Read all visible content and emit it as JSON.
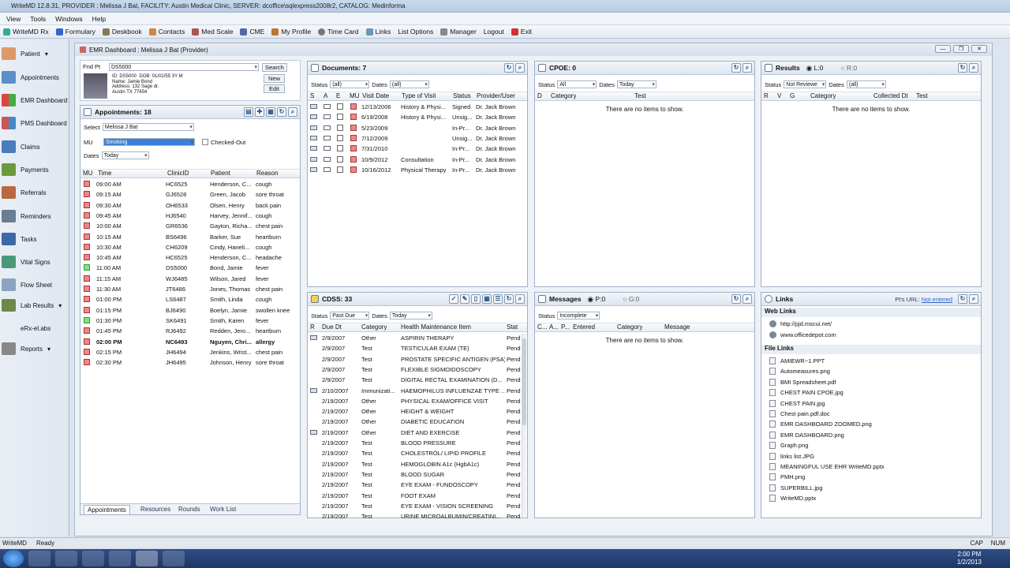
{
  "window": {
    "title": "WriteMD 12.8.31, PROVIDER : Melissa J Bat, FACILITY: Austin Medical Clinic, SERVER: dcoffice\\sqlexpress2008r2, CATALOG: Medinforma"
  },
  "menu": [
    "View",
    "Tools",
    "Windows",
    "Help"
  ],
  "toolbar": [
    "WriteMD Rx",
    "Formulary",
    "Deskbook",
    "Contacts",
    "Med Scale",
    "CME",
    "My Profile",
    "Time Card",
    "Links",
    "List Options",
    "Manager",
    "Logout",
    "Exit"
  ],
  "nav": [
    "Patient",
    "Appointments",
    "EMR Dashboard",
    "PMS Dashboard",
    "Claims",
    "Payments",
    "Referrals",
    "Reminders",
    "Tasks",
    "Vital Signs",
    "Flow Sheet",
    "Lab Results",
    "eRx-el.abs",
    "Reports"
  ],
  "dashboard": {
    "title": "EMR Dashboard : Melissa J Bat (Provider)"
  },
  "patient": {
    "find_label": "Fnd Pt",
    "find_value": "DS5000",
    "search": "Search",
    "new": "New",
    "edit": "Edit",
    "id": "ID: DS5000",
    "dob": "DOB: 01/02/55  3Y M",
    "name": "Name: Jamie Bond",
    "address": "Address: 132 Sage dr.",
    "city": "Austin  TX  77654"
  },
  "appointments": {
    "title": "Appointments: 18",
    "select_label": "Select",
    "select_value": "Melissa J Bat",
    "mu_label": "MU",
    "mu_value": "Smoking",
    "checked_out": "Checked-Out",
    "dates_label": "Dates",
    "dates_value": "Today",
    "columns": [
      "MU",
      "Time",
      "ClinicID",
      "Patient",
      "Reason"
    ],
    "rows": [
      {
        "time": "09:00 AM",
        "id": "HC6525",
        "patient": "Henderson, C...",
        "reason": "cough"
      },
      {
        "time": "09:15 AM",
        "id": "GJ6528",
        "patient": "Green, Jacob",
        "reason": "sore throat"
      },
      {
        "time": "09:30 AM",
        "id": "OH6533",
        "patient": "Olsen, Henry",
        "reason": "back pain"
      },
      {
        "time": "09:45 AM",
        "id": "HJ6540",
        "patient": "Harvey, Jennif...",
        "reason": "cough"
      },
      {
        "time": "10:00 AM",
        "id": "GR6536",
        "patient": "Gayton, Richa...",
        "reason": "chest pain"
      },
      {
        "time": "10:15 AM",
        "id": "BS6496",
        "patient": "Barker, Sue",
        "reason": "heartburn"
      },
      {
        "time": "10:30 AM",
        "id": "CH6209",
        "patient": "Cindy, Haneli...",
        "reason": "cough"
      },
      {
        "time": "10:45 AM",
        "id": "HC6525",
        "patient": "Henderson, C...",
        "reason": "headache"
      },
      {
        "time": "11:00 AM",
        "id": "DS5000",
        "patient": "Bond, Jamie",
        "reason": "fever"
      },
      {
        "time": "11:15 AM",
        "id": "WJ6485",
        "patient": "Wilson, Jared",
        "reason": "fever"
      },
      {
        "time": "11:30 AM",
        "id": "JT6486",
        "patient": "Jones, Thomas",
        "reason": "chest pain"
      },
      {
        "time": "01:00 PM",
        "id": "LS6487",
        "patient": "Smith, Linda",
        "reason": "cough"
      },
      {
        "time": "01:15 PM",
        "id": "BJ6490",
        "patient": "Boelyn, Jamie",
        "reason": "swollen knee"
      },
      {
        "time": "01:30 PM",
        "id": "SK6491",
        "patient": "Smith, Karen",
        "reason": "fever"
      },
      {
        "time": "01:45 PM",
        "id": "RJ6492",
        "patient": "Redden, Jero...",
        "reason": "heartburn"
      },
      {
        "time": "02:00 PM",
        "id": "NC6493",
        "patient": "Nguyen, Chri...",
        "reason": "allergy"
      },
      {
        "time": "02:15 PM",
        "id": "JH6494",
        "patient": "Jenkins, Wrist...",
        "reason": "chest pain"
      },
      {
        "time": "02:30 PM",
        "id": "JH6495",
        "patient": "Johnson, Henry",
        "reason": "sore throat"
      }
    ],
    "tabs": [
      "Appointments",
      "Resources",
      "Rounds",
      "Work List"
    ]
  },
  "documents": {
    "title": "Documents: 7",
    "status_label": "Status",
    "status_value": "(all)",
    "dates_label": "Dates",
    "dates_value": "(all)",
    "columns": [
      "S",
      "A",
      "E",
      "MU",
      "Visit Date",
      "Type of Visit",
      "Status",
      "Provider/User"
    ],
    "rows": [
      {
        "date": "12/13/2006",
        "type": "History & Physi...",
        "status": "Signed",
        "provider": "Dr. Jack Brown"
      },
      {
        "date": "6/19/2008",
        "type": "History & Physi...",
        "status": "Unsig...",
        "provider": "Dr. Jack Brown"
      },
      {
        "date": "5/23/2009",
        "type": "",
        "status": "In-Pr...",
        "provider": "Dr. Jack Brown"
      },
      {
        "date": "7/12/2009",
        "type": "",
        "status": "Unsig...",
        "provider": "Dr. Jack Brown"
      },
      {
        "date": "7/31/2010",
        "type": "",
        "status": "In-Pr...",
        "provider": "Dr. Jack Brown"
      },
      {
        "date": "10/9/2012",
        "type": "Consultation",
        "status": "In-Pr...",
        "provider": "Dr. Jack Brown"
      },
      {
        "date": "10/16/2012",
        "type": "Physical Therapy",
        "status": "In-Pr...",
        "provider": "Dr. Jack Brown"
      }
    ]
  },
  "cpoe": {
    "title": "CPOE: 0",
    "status_label": "Status",
    "status_value": "All",
    "dates_label": "Dates",
    "dates_value": "Today",
    "columns": [
      "D",
      "Category",
      "Test"
    ],
    "empty": "There are no items to show."
  },
  "results": {
    "title": "Results",
    "l": "L:0",
    "r": "R:0",
    "status_label": "Status",
    "status_value": "Not Reviewe",
    "dates_label": "Dates",
    "dates_value": "(all)",
    "columns": [
      "R",
      "V",
      "G",
      "Category",
      "Collected Dt",
      "Test"
    ],
    "empty": "There are no items to show."
  },
  "cdss": {
    "title": "CDSS: 33",
    "status_label": "Status",
    "status_value": "Past Due",
    "dates_label": "Dates",
    "dates_value": "Today",
    "columns": [
      "R",
      "Due Dt",
      "Category",
      "Health Maintenance Item",
      "Stat"
    ],
    "rows": [
      {
        "due": "2/9/2007",
        "cat": "Other",
        "item": "ASPIRIN THERAPY",
        "stat": "Pend"
      },
      {
        "due": "2/9/2007",
        "cat": "Test",
        "item": "TESTICULAR EXAM (TE)",
        "stat": "Pend"
      },
      {
        "due": "2/9/2007",
        "cat": "Test",
        "item": "PROSTATE SPECIFIC ANTIGEN (PSA)",
        "stat": "Pend"
      },
      {
        "due": "2/9/2007",
        "cat": "Test",
        "item": "FLEXIBLE SIGMOIDOSCOPY",
        "stat": "Pend"
      },
      {
        "due": "2/9/2007",
        "cat": "Test",
        "item": "DIGITAL RECTAL EXAMINATION (D...",
        "stat": "Pend"
      },
      {
        "due": "2/10/2007",
        "cat": "Immunizati...",
        "item": "HAEMOPHILUS INFLUENZAE TYPE ...",
        "stat": "Pend"
      },
      {
        "due": "2/19/2007",
        "cat": "Other",
        "item": "PHYSICAL EXAM/OFFICE VISIT",
        "stat": "Pend"
      },
      {
        "due": "2/19/2007",
        "cat": "Other",
        "item": "HEIGHT & WEIGHT",
        "stat": "Pend"
      },
      {
        "due": "2/19/2007",
        "cat": "Other",
        "item": "DIABETIC EDUCATION",
        "stat": "Pend"
      },
      {
        "due": "2/19/2007",
        "cat": "Other",
        "item": "DIET AND EXERCISE",
        "stat": "Pend"
      },
      {
        "due": "2/19/2007",
        "cat": "Test",
        "item": "BLOOD PRESSURE",
        "stat": "Pend"
      },
      {
        "due": "2/19/2007",
        "cat": "Test",
        "item": "CHOLESTROL/ LIPID PROFILE",
        "stat": "Pend"
      },
      {
        "due": "2/19/2007",
        "cat": "Test",
        "item": "HEMOGLOBIN A1c (HgbA1c)",
        "stat": "Pend"
      },
      {
        "due": "2/19/2007",
        "cat": "Test",
        "item": "BLOOD SUGAR",
        "stat": "Pend"
      },
      {
        "due": "2/19/2007",
        "cat": "Test",
        "item": "EYE EXAM - FUNDOSCOPY",
        "stat": "Pend"
      },
      {
        "due": "2/19/2007",
        "cat": "Test",
        "item": "FOOT EXAM",
        "stat": "Pend"
      },
      {
        "due": "2/19/2007",
        "cat": "Test",
        "item": "EYE EXAM - VISION SCREENING",
        "stat": "Pend"
      },
      {
        "due": "2/19/2007",
        "cat": "Test",
        "item": "URINE MICROALBUMIN/CREATINI...",
        "stat": "Pend"
      }
    ]
  },
  "messages": {
    "title": "Messages",
    "p": "P:0",
    "g": "G:0",
    "status_label": "Status",
    "status_value": "Incomplete",
    "columns": [
      "C...",
      "A...",
      "P...",
      "Entered",
      "Category",
      "Message"
    ],
    "empty": "There are no items to show."
  },
  "links": {
    "title": "Links",
    "pts_url_label": "Pt's URL:",
    "pts_url_value": "Not entered",
    "web_label": "Web Links",
    "web": [
      "http://pjd.mscui.net/",
      "www.officedepot.com"
    ],
    "file_label": "File Links",
    "files": [
      "AMIEWR~1.PPT",
      "Automeasures.png",
      "BMI Spreadsheet.pdf",
      "CHEST PAIN CPOE.jpg",
      "CHEST PAIN.jpg",
      "Chest pain.pdf.doc",
      "EMR DASHBOARD ZOOMED.png",
      "EMR DASHBOARD.png",
      "Graph.png",
      "links list.JPG",
      "MEANINGFUL USE EHR WriteMD.pptx",
      "PMH.png",
      "SUPERBILL.jpg",
      "WriteMD.pptx"
    ]
  },
  "statusbar": {
    "app": "WriteMD",
    "state": "Ready",
    "cap": "CAP",
    "num": "NUM"
  },
  "clock": {
    "time": "2:00 PM",
    "date": "1/2/2013"
  }
}
